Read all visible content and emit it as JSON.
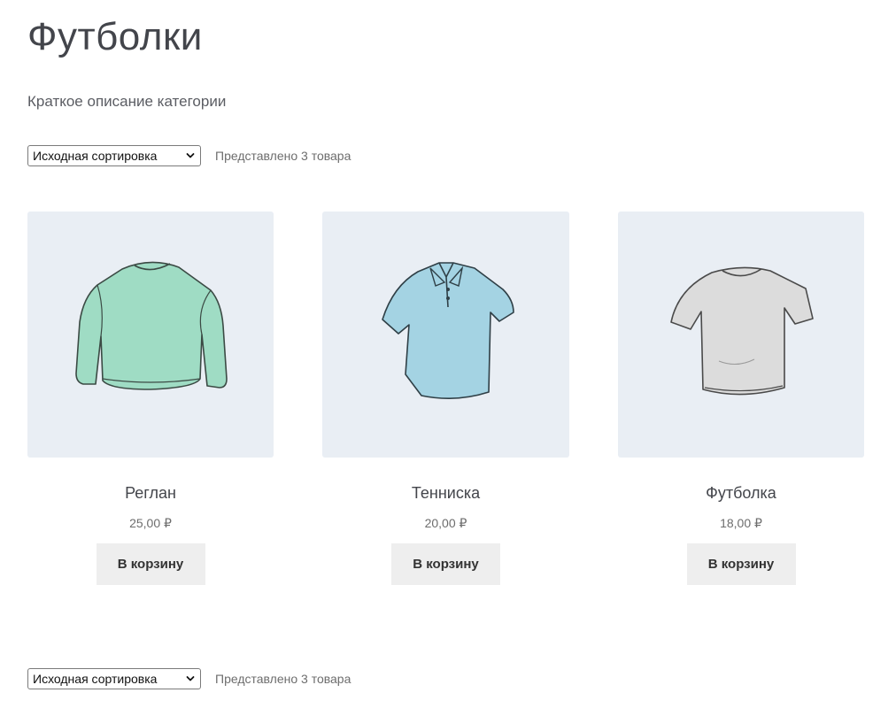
{
  "page": {
    "title": "Футболки",
    "description": "Краткое описание категории"
  },
  "sorting": {
    "selected": "Исходная сортировка",
    "result_count": "Представлено 3 товара"
  },
  "products": [
    {
      "name": "Реглан",
      "price": "25,00 ₽",
      "button": "В корзину",
      "image_icon": "longsleeve-shirt-icon",
      "color": "#9fdcc4"
    },
    {
      "name": "Тенниска",
      "price": "20,00 ₽",
      "button": "В корзину",
      "image_icon": "polo-shirt-icon",
      "color": "#a4d3e3"
    },
    {
      "name": "Футболка",
      "price": "18,00 ₽",
      "button": "В корзину",
      "image_icon": "tshirt-icon",
      "color": "#d9d9d9"
    }
  ],
  "colors": {
    "image_bg": "#e9eef4",
    "button_bg": "#eeeeee",
    "text": "#43454b"
  }
}
